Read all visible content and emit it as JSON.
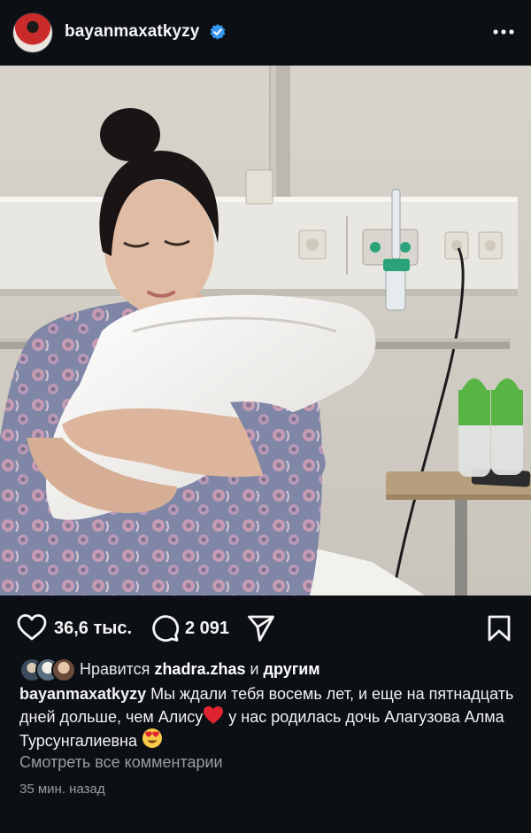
{
  "post": {
    "username": "bayanmaxatkyzy",
    "verified": true
  },
  "actions": {
    "likes": "36,6 тыс.",
    "comments": "2 091"
  },
  "liked_by": {
    "prefix": "Нравится ",
    "user": "zhadra.zhas",
    "conjunction": " и ",
    "others": "другим"
  },
  "caption": {
    "username": "bayanmaxatkyzy",
    "text_part1": " Мы ждали тебя восемь лет, и еще на пятнадцать дней дольше, чем Алису",
    "text_part2": " у нас родилась дочь Алагузова Алма Турсунгалиевна "
  },
  "view_comments": "Смотреть все комментарии",
  "time_ago": "35 мин. назад",
  "colors": {
    "background": "#0c0f14",
    "verified": "#3897f0",
    "secondary_text": "#9a9ca2",
    "heart": "#e0242f"
  },
  "icons": [
    "verified-badge-icon",
    "more-options-icon",
    "heart-icon",
    "comment-icon",
    "share-icon",
    "bookmark-icon"
  ]
}
